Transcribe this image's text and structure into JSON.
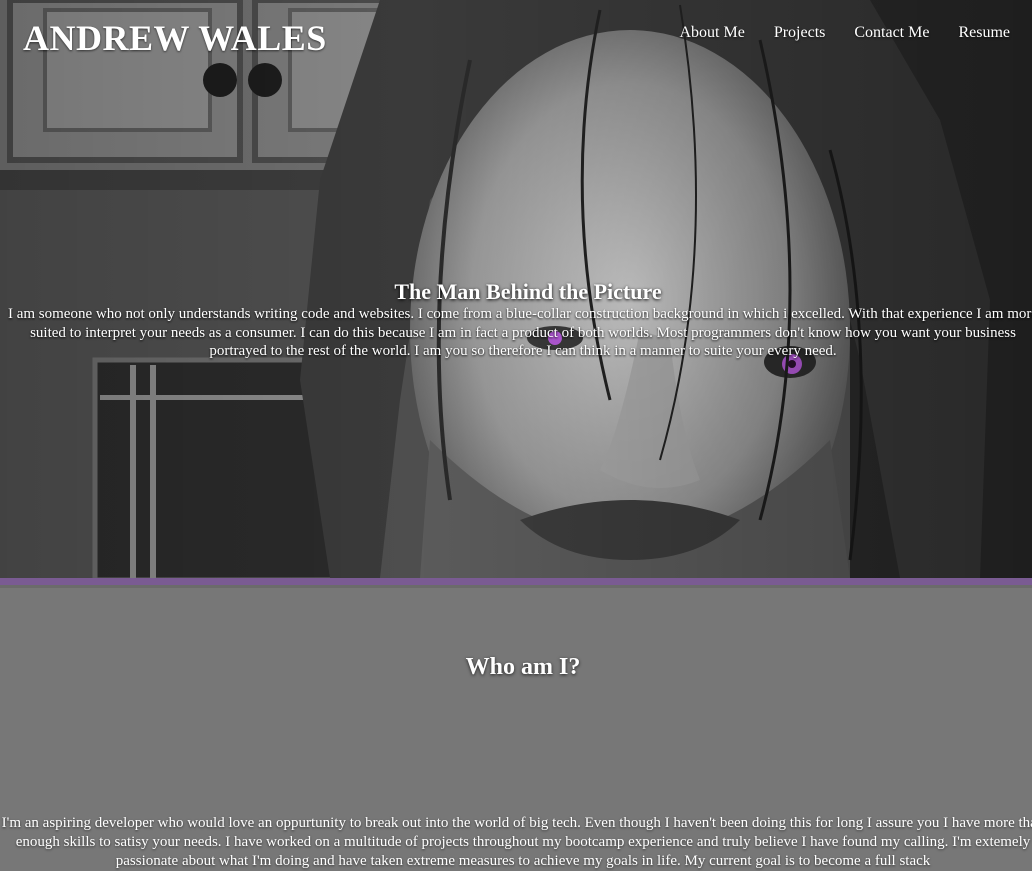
{
  "header": {
    "brand": "ANDREW WALES",
    "nav": [
      "About Me",
      "Projects",
      "Contact Me",
      "Resume"
    ]
  },
  "hero": {
    "title": "The Man Behind the Picture",
    "text": "I am someone who not only understands writing code and websites. I come from a blue-collar construction background in which i excelled. With that experience I am more suited to interpret your needs as a consumer. I can do this because I am in fact a product of both worlds. Most programmers don't know how you want your business portrayed to the rest of the world. I am you so therefore I can think in a manner to suite your every need."
  },
  "about": {
    "title": "Who am I?",
    "text": "I'm an aspiring developer who would love an oppurtunity to break out into the world of big tech. Even though I haven't been doing this for long I assure you I have more than enough skills to satisy your needs. I have worked on a multitude of projects throughout my bootcamp experience and truly believe I have found my calling. I'm extemely passionate about what I'm doing and have taken extreme measures to achieve my goals in life. My current goal is to become a full stack"
  },
  "colors": {
    "accent": "#7a5b93",
    "section_bg": "#777777",
    "eye": "#b55ad9"
  }
}
